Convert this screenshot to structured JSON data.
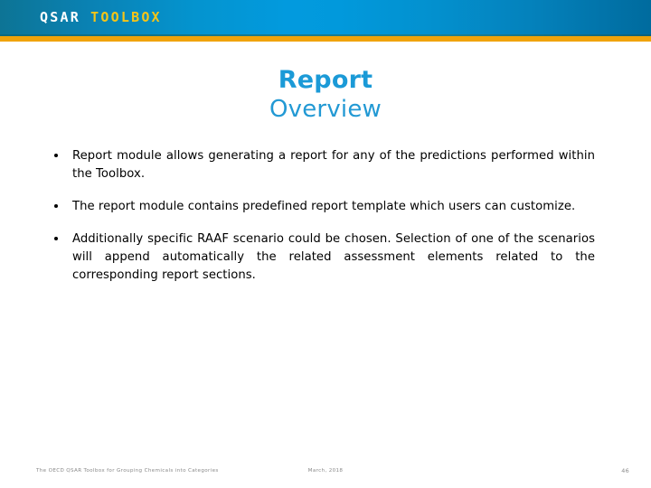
{
  "header": {
    "logo": {
      "primary": "QSAR",
      "secondary": "TOOLBOX",
      "primary_color": "#ffffff",
      "secondary_color": "#f5c518"
    },
    "band_gradient_left": "#0d7495",
    "band_gradient_center": "#0199dc",
    "band_gradient_right": "#006b9e",
    "accent_bar_color": "#f0a30a"
  },
  "title": {
    "main": "Report",
    "sub": "Overview",
    "color": "#1b9ad7"
  },
  "body": {
    "bullets": [
      "Report module allows generating a report for any of the predictions performed within the Toolbox.",
      "The report module contains predefined report template which users can customize.",
      "Additionally specific RAAF scenario could be chosen. Selection of one of the scenarios will append automatically the related assessment elements related to the corresponding report sections."
    ]
  },
  "footer": {
    "left": "The OECD QSAR Toolbox for Grouping Chemicals into Categories",
    "center": "March, 2018",
    "page_number": "46",
    "color": "#8a8a8a"
  }
}
